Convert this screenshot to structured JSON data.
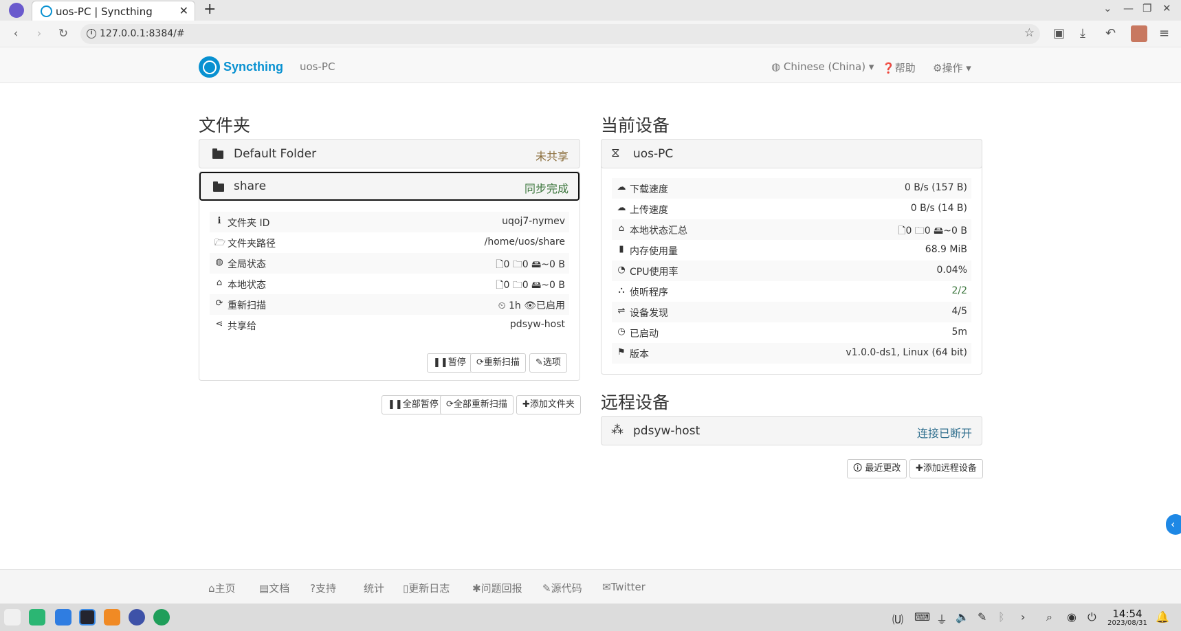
{
  "browser": {
    "tab_title": "uos-PC | Syncthing",
    "url": "127.0.0.1:8384/#"
  },
  "navbar": {
    "brand": "Syncthing",
    "device": "uos-PC",
    "language": "Chinese (China)",
    "help": "帮助",
    "actions": "操作"
  },
  "folders": {
    "heading": "文件夹",
    "default": {
      "name": "Default Folder",
      "status": "未共享"
    },
    "share": {
      "name": "share",
      "status": "同步完成",
      "rows": [
        {
          "label": "文件夹 ID",
          "value": "uqoj7-nymev",
          "icon": "info-icon"
        },
        {
          "label": "文件夹路径",
          "value": "/home/uos/share",
          "icon": "folder-open-icon"
        },
        {
          "label": "全局状态",
          "value": "🗋0  🗀0  🖴~0 B",
          "icon": "globe-icon"
        },
        {
          "label": "本地状态",
          "value": "🗋0  🗀0  🖴~0 B",
          "icon": "home-icon"
        },
        {
          "label": "重新扫描",
          "value": "⏲ 1h  👁已启用",
          "icon": "refresh-icon"
        },
        {
          "label": "共享给",
          "value": "pdsyw-host",
          "icon": "share-icon"
        }
      ],
      "btn_pause": "暂停",
      "btn_rescan": "重新扫描",
      "btn_options": "选项"
    },
    "btn_pause_all": "全部暂停",
    "btn_rescan_all": "全部重新扫描",
    "btn_add": "添加文件夹"
  },
  "this_device": {
    "heading": "当前设备",
    "name": "uos-PC",
    "rows": [
      {
        "label": "下载速度",
        "value": "0 B/s (157 B)",
        "icon": "cloud-download-icon"
      },
      {
        "label": "上传速度",
        "value": "0 B/s (14 B)",
        "icon": "cloud-upload-icon"
      },
      {
        "label": "本地状态汇总",
        "value": "🗋0  🗀0  🖴~0 B",
        "icon": "home-icon"
      },
      {
        "label": "内存使用量",
        "value": "68.9 MiB",
        "icon": "memory-icon"
      },
      {
        "label": "CPU使用率",
        "value": "0.04%",
        "icon": "dashboard-icon"
      },
      {
        "label": "侦听程序",
        "value": "2/2",
        "icon": "sitemap-icon"
      },
      {
        "label": "设备发现",
        "value": "4/5",
        "icon": "signpost-icon"
      },
      {
        "label": "已启动",
        "value": "5m",
        "icon": "clock-icon"
      },
      {
        "label": "版本",
        "value": "v1.0.0-ds1, Linux (64 bit)",
        "icon": "tag-icon"
      }
    ]
  },
  "remote": {
    "heading": "远程设备",
    "name": "pdsyw-host",
    "status": "连接已断开",
    "btn_recent": "最近更改",
    "btn_add": "添加远程设备"
  },
  "footer": [
    "主页",
    "文档",
    "支持",
    "统计",
    "更新日志",
    "问题回报",
    "源代码",
    "Twitter"
  ],
  "taskbar": {
    "time": "14:54",
    "date": "2023/08/31"
  },
  "colors": {
    "brand": "#0891d1",
    "success": "#3c763d",
    "warning": "#8a6d3b",
    "info": "#31708f"
  }
}
